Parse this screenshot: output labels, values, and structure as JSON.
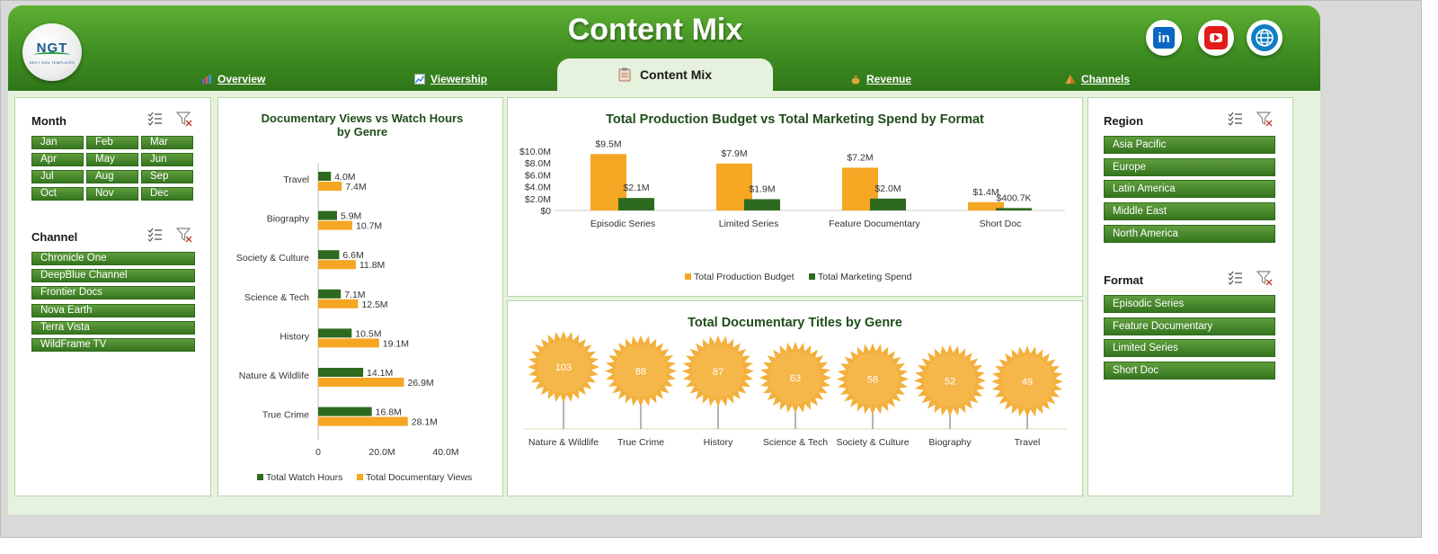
{
  "header": {
    "title": "Content Mix",
    "logo_text": "NGT",
    "logo_subtext": "NEXT GEN TEMPLATES"
  },
  "tabs": [
    {
      "label": "Overview",
      "icon": "bar-chart-icon"
    },
    {
      "label": "Viewership",
      "icon": "line-chart-icon"
    },
    {
      "label": "Content Mix",
      "icon": "clipboard-icon",
      "active": true
    },
    {
      "label": "Revenue",
      "icon": "money-bag-icon"
    },
    {
      "label": "Channels",
      "icon": "pyramid-icon"
    }
  ],
  "social": {
    "linkedin": "in"
  },
  "slicers": {
    "month": {
      "title": "Month",
      "items": [
        "Jan",
        "Feb",
        "Mar",
        "Apr",
        "May",
        "Jun",
        "Jul",
        "Aug",
        "Sep",
        "Oct",
        "Nov",
        "Dec"
      ]
    },
    "channel": {
      "title": "Channel",
      "items": [
        "Chronicle One",
        "DeepBlue Channel",
        "Frontier Docs",
        "Nova Earth",
        "Terra Vista",
        "WildFrame TV"
      ]
    },
    "region": {
      "title": "Region",
      "items": [
        "Asia Pacific",
        "Europe",
        "Latin America",
        "Middle East",
        "North America"
      ]
    },
    "format": {
      "title": "Format",
      "items": [
        "Episodic Series",
        "Feature Documentary",
        "Limited Series",
        "Short Doc"
      ]
    }
  },
  "colors": {
    "orange": "#f5a623",
    "green": "#2d6a1f",
    "header_green": "#4a9f2a"
  },
  "chart_data": [
    {
      "type": "bar",
      "orientation": "horizontal",
      "title": "Documentary Views vs Watch Hours by Genre",
      "title_lines": [
        "Documentary Views vs Watch Hours",
        "by Genre"
      ],
      "categories": [
        "Travel",
        "Biography",
        "Society & Culture",
        "Science & Tech",
        "History",
        "Nature & Wildlife",
        "True Crime"
      ],
      "series": [
        {
          "name": "Total Watch Hours",
          "values": [
            4.0,
            5.9,
            6.6,
            7.1,
            10.5,
            14.1,
            16.8
          ],
          "labels": [
            "4.0M",
            "5.9M",
            "6.6M",
            "7.1M",
            "10.5M",
            "14.1M",
            "16.8M"
          ],
          "color": "#2d6a1f"
        },
        {
          "name": "Total Documentary Views",
          "values": [
            7.4,
            10.7,
            11.8,
            12.5,
            19.1,
            26.9,
            28.1
          ],
          "labels": [
            "7.4M",
            "10.7M",
            "11.8M",
            "12.5M",
            "19.1M",
            "26.9M",
            "28.1M"
          ],
          "color": "#f5a623"
        }
      ],
      "xlim": [
        0,
        40
      ],
      "xticks": [
        "0",
        "20.0M",
        "40.0M"
      ],
      "legend": "bottom"
    },
    {
      "type": "bar",
      "title": "Total Production Budget vs Total Marketing Spend by Format",
      "categories": [
        "Episodic Series",
        "Limited Series",
        "Feature Documentary",
        "Short Doc"
      ],
      "series": [
        {
          "name": "Total Production Budget",
          "values": [
            9.5,
            7.9,
            7.2,
            1.4
          ],
          "labels": [
            "$9.5M",
            "$7.9M",
            "$7.2M",
            "$1.4M"
          ],
          "color": "#f5a623"
        },
        {
          "name": "Total Marketing Spend",
          "values": [
            2.1,
            1.9,
            2.0,
            0.4007
          ],
          "labels": [
            "$2.1M",
            "$1.9M",
            "$2.0M",
            "$400.7K"
          ],
          "color": "#2d6a1f"
        }
      ],
      "ylim": [
        0,
        10
      ],
      "yticks": [
        "$0",
        "$2.0M",
        "$4.0M",
        "$6.0M",
        "$8.0M",
        "$10.0M"
      ],
      "legend": "bottom"
    },
    {
      "type": "bar",
      "style": "sunburst-pictogram",
      "title": "Total Documentary Titles by Genre",
      "categories": [
        "Nature & Wildlife",
        "True Crime",
        "History",
        "Science & Tech",
        "Society & Culture",
        "Biography",
        "Travel"
      ],
      "values": [
        103,
        88,
        87,
        63,
        58,
        52,
        49
      ]
    }
  ]
}
